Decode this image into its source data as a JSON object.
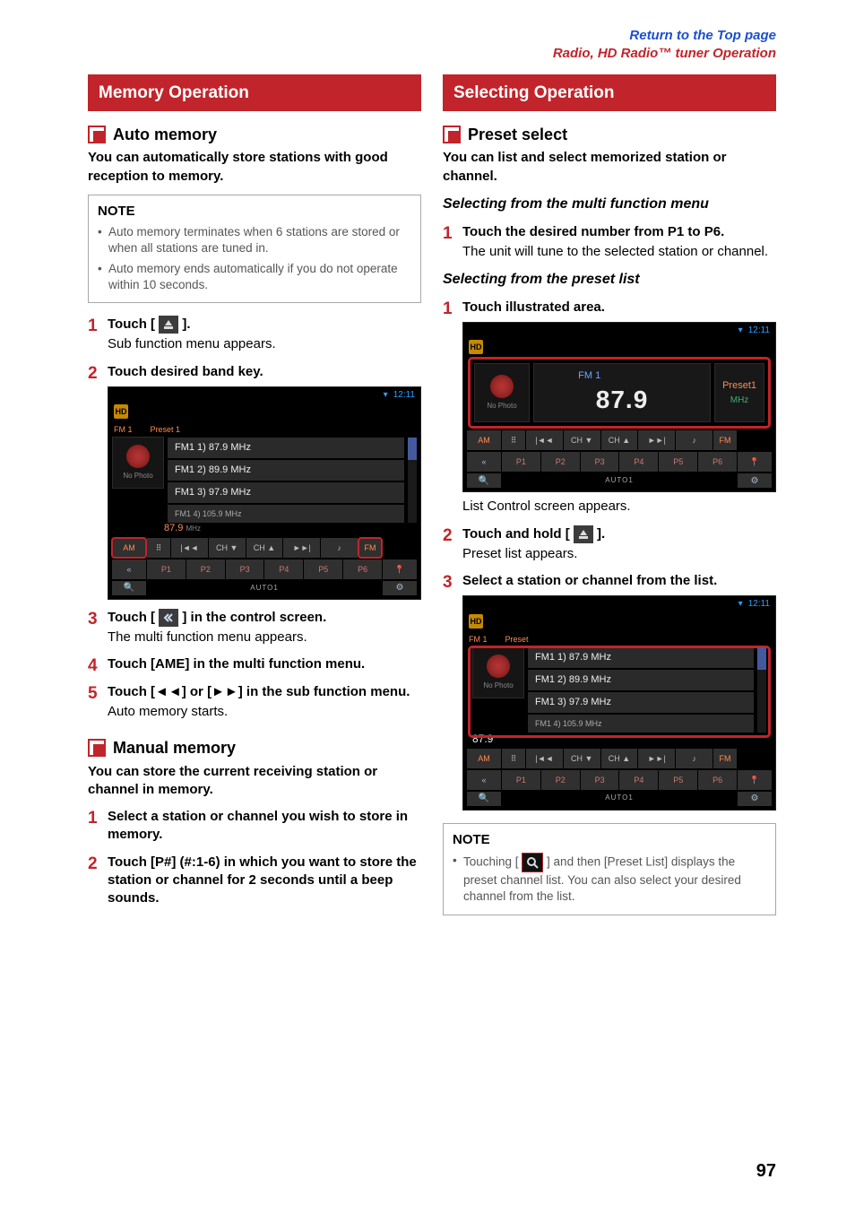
{
  "header": {
    "link1": "Return to the Top page",
    "link2": "Radio, HD Radio™ tuner Operation"
  },
  "page_number": "97",
  "left": {
    "section_title": "Memory Operation",
    "auto_memory": {
      "heading": "Auto memory",
      "lead": "You can automatically store stations with good reception to memory.",
      "note_title": "NOTE",
      "notes": [
        "Auto memory terminates when 6 stations are stored or when all stations are tuned in.",
        "Auto memory ends automatically if you do not operate within 10 seconds."
      ],
      "steps": [
        {
          "main_pre": "Touch [ ",
          "main_post": " ].",
          "sub": "Sub function menu appears."
        },
        {
          "main": "Touch desired band key."
        },
        {
          "main_pre": "Touch [ ",
          "main_post": " ] in the control screen.",
          "sub": "The multi function menu appears."
        },
        {
          "main": "Touch [AME] in the multi function menu."
        },
        {
          "main": "Touch [◄◄] or [►►] in the sub function menu.",
          "sub": "Auto memory starts."
        }
      ]
    },
    "manual_memory": {
      "heading": "Manual memory",
      "lead": "You can store the current receiving station or channel in memory.",
      "steps": [
        {
          "main": "Select a station or channel you wish to store in memory."
        },
        {
          "main": "Touch [P#] (#:1-6) in which you want to store the station or channel for 2 seconds until a beep sounds."
        }
      ]
    },
    "screenshot1": {
      "clock": "12:11",
      "band_label": "FM 1",
      "preset_label": "Preset 1",
      "no_photo": "No Photo",
      "rows": [
        "FM1 1) 87.9 MHz",
        "FM1 2) 89.9 MHz",
        "FM1 3) 97.9 MHz",
        "FM1 4) 105.9 MHz"
      ],
      "freq_small": "87.9",
      "row1": [
        "AM",
        "",
        "|◄◄",
        "CH ▼",
        "CH ▲",
        "►►|",
        "♪",
        "FM"
      ],
      "row2": [
        "«",
        "P1",
        "P2",
        "P3",
        "P4",
        "P5",
        "P6",
        ""
      ],
      "foot_label": "AUTO1"
    }
  },
  "right": {
    "section_title": "Selecting Operation",
    "preset_select": {
      "heading": "Preset select",
      "lead": "You can list and select memorized station or channel.",
      "sub1_title": "Selecting from the multi function menu",
      "sub1_steps": [
        {
          "main": "Touch the desired number from P1 to P6.",
          "sub": "The unit will tune to the selected station or channel."
        }
      ],
      "sub2_title": "Selecting from the preset list",
      "sub2_steps": [
        {
          "main": "Touch illustrated area."
        },
        {
          "sub_above": "List Control screen appears.",
          "main_pre": "Touch and hold [ ",
          "main_post": " ].",
          "sub": "Preset list appears."
        },
        {
          "main": "Select a station or channel from the list."
        }
      ],
      "note_title": "NOTE",
      "note_pre": "Touching [ ",
      "note_post": " ] and then [Preset List] displays the preset channel list. You can also select your desired channel from the list."
    },
    "screenshot2": {
      "clock": "12:11",
      "no_photo": "No Photo",
      "fm": "FM 1",
      "freq": "87.9",
      "preset": "Preset1",
      "mhz": "MHz",
      "row1": [
        "AM",
        "",
        "|◄◄",
        "CH ▼",
        "CH ▲",
        "►►|",
        "♪",
        "FM"
      ],
      "row2": [
        "«",
        "P1",
        "P2",
        "P3",
        "P4",
        "P5",
        "P6",
        ""
      ],
      "foot_label": "AUTO1"
    },
    "screenshot3": {
      "clock": "12:11",
      "band_label": "FM 1",
      "preset_label": "Preset",
      "no_photo": "No Photo",
      "freq_small": "87.9",
      "rows": [
        "FM1 1) 87.9 MHz",
        "FM1 2) 89.9 MHz",
        "FM1 3) 97.9 MHz",
        "FM1 4) 105.9 MHz"
      ],
      "row1": [
        "AM",
        "",
        "|◄◄",
        "CH ▼",
        "CH ▲",
        "►►|",
        "♪",
        "FM"
      ],
      "row2": [
        "«",
        "P1",
        "P2",
        "P3",
        "P4",
        "P5",
        "P6",
        ""
      ],
      "foot_label": "AUTO1"
    }
  }
}
